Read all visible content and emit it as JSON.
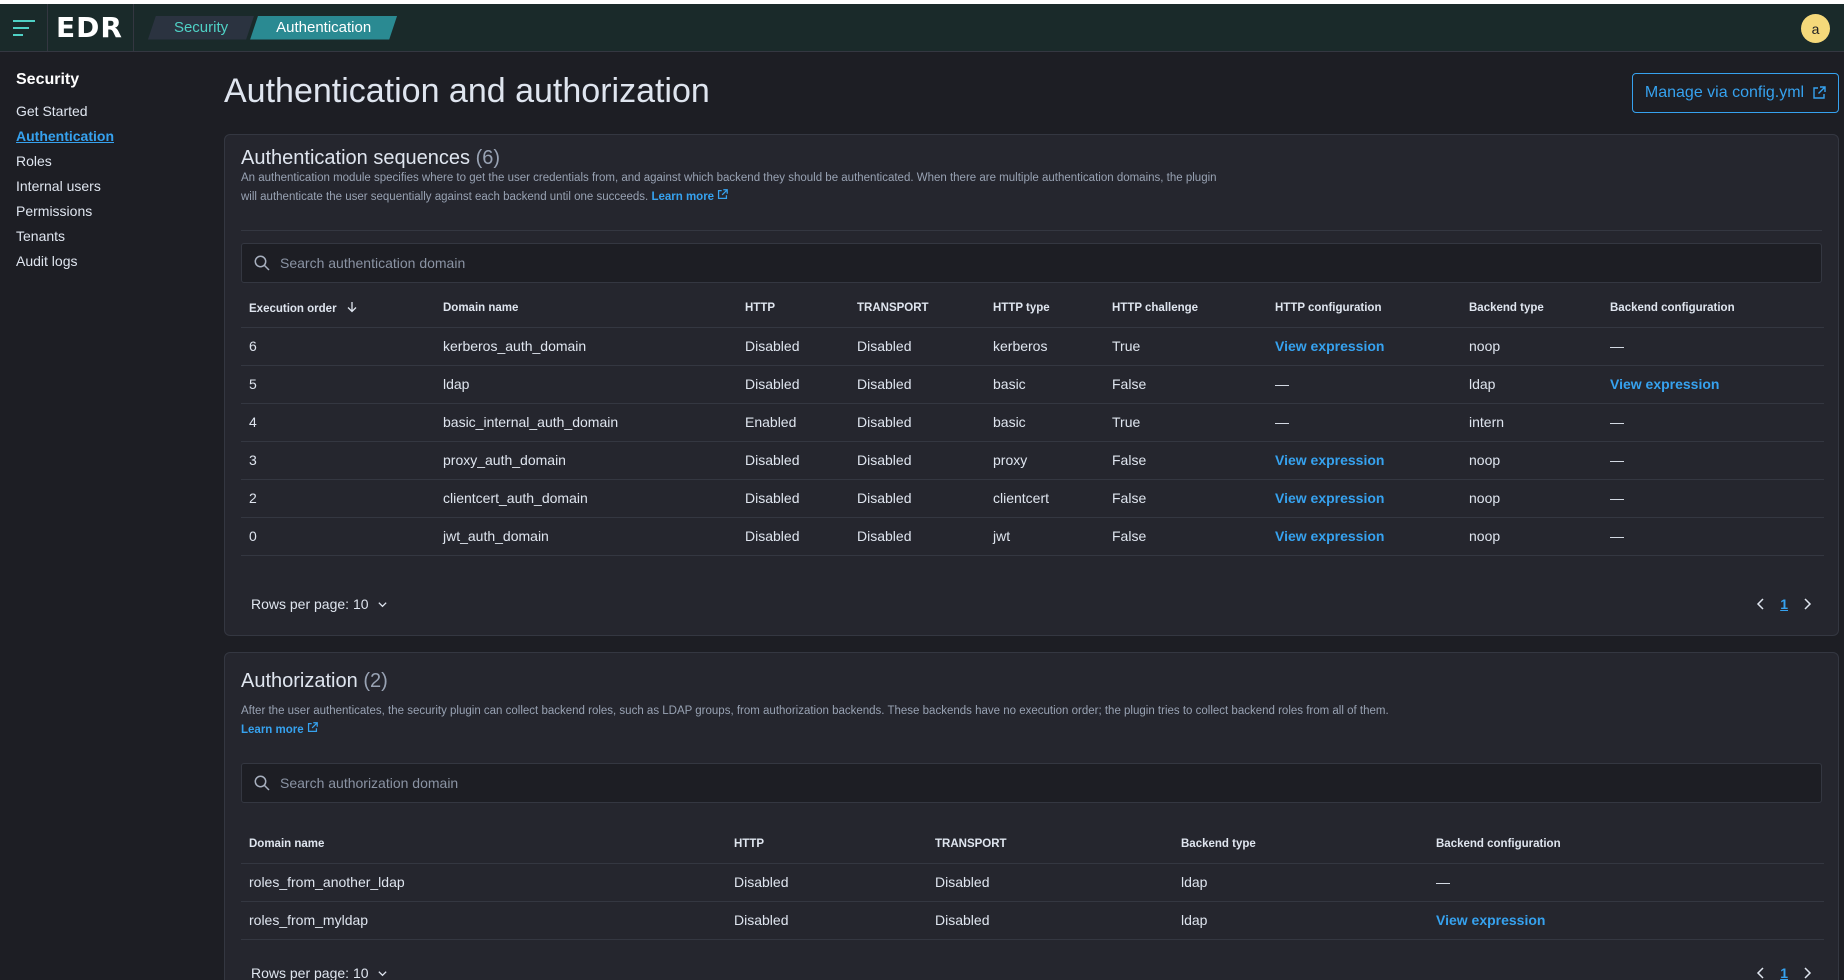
{
  "header": {
    "logo": "EDR",
    "breadcrumbs": [
      "Security",
      "Authentication"
    ],
    "avatar_initial": "a"
  },
  "sidebar": {
    "title": "Security",
    "items": [
      {
        "label": "Get Started",
        "active": false
      },
      {
        "label": "Authentication",
        "active": true
      },
      {
        "label": "Roles",
        "active": false
      },
      {
        "label": "Internal users",
        "active": false
      },
      {
        "label": "Permissions",
        "active": false
      },
      {
        "label": "Tenants",
        "active": false
      },
      {
        "label": "Audit logs",
        "active": false
      }
    ]
  },
  "main": {
    "title": "Authentication and authorization",
    "manage_button": "Manage via config.yml"
  },
  "authentication": {
    "title": "Authentication sequences",
    "count": "(6)",
    "description": "An authentication module specifies where to get the user credentials from, and against which backend they should be authenticated. When there are multiple authentication domains, the plugin will authenticate the user sequentially against each backend until one succeeds.",
    "learn_more": "Learn more",
    "search_placeholder": "Search authentication domain",
    "columns": [
      "Execution order",
      "Domain name",
      "HTTP",
      "TRANSPORT",
      "HTTP type",
      "HTTP challenge",
      "HTTP configuration",
      "Backend type",
      "Backend configuration"
    ],
    "rows": [
      [
        "6",
        "kerberos_auth_domain",
        "Disabled",
        "Disabled",
        "kerberos",
        "True",
        "View expression",
        "noop",
        "—"
      ],
      [
        "5",
        "ldap",
        "Disabled",
        "Disabled",
        "basic",
        "False",
        "—",
        "ldap",
        "View expression"
      ],
      [
        "4",
        "basic_internal_auth_domain",
        "Enabled",
        "Disabled",
        "basic",
        "True",
        "—",
        "intern",
        "—"
      ],
      [
        "3",
        "proxy_auth_domain",
        "Disabled",
        "Disabled",
        "proxy",
        "False",
        "View expression",
        "noop",
        "—"
      ],
      [
        "2",
        "clientcert_auth_domain",
        "Disabled",
        "Disabled",
        "clientcert",
        "False",
        "View expression",
        "noop",
        "—"
      ],
      [
        "0",
        "jwt_auth_domain",
        "Disabled",
        "Disabled",
        "jwt",
        "False",
        "View expression",
        "noop",
        "—"
      ]
    ],
    "rows_per_page": "Rows per page: 10",
    "page": "1"
  },
  "authorization": {
    "title": "Authorization",
    "count": "(2)",
    "description": "After the user authenticates, the security plugin can collect backend roles, such as LDAP groups, from authorization backends. These backends have no execution order; the plugin tries to collect backend roles from all of them.",
    "learn_more": "Learn more",
    "search_placeholder": "Search authorization domain",
    "columns": [
      "Domain name",
      "HTTP",
      "TRANSPORT",
      "Backend type",
      "Backend configuration"
    ],
    "rows": [
      [
        "roles_from_another_ldap",
        "Disabled",
        "Disabled",
        "ldap",
        "—"
      ],
      [
        "roles_from_myldap",
        "Disabled",
        "Disabled",
        "ldap",
        "View expression"
      ]
    ],
    "rows_per_page": "Rows per page: 10",
    "page": "1"
  },
  "colors": {
    "accent": "#36a2ef",
    "header_bg": "#1a2a2a",
    "crumb_active": "#2a8a92",
    "crumb_text": "#4fd1c5",
    "panel_bg": "#25262e",
    "page_bg": "#1d1e24"
  }
}
